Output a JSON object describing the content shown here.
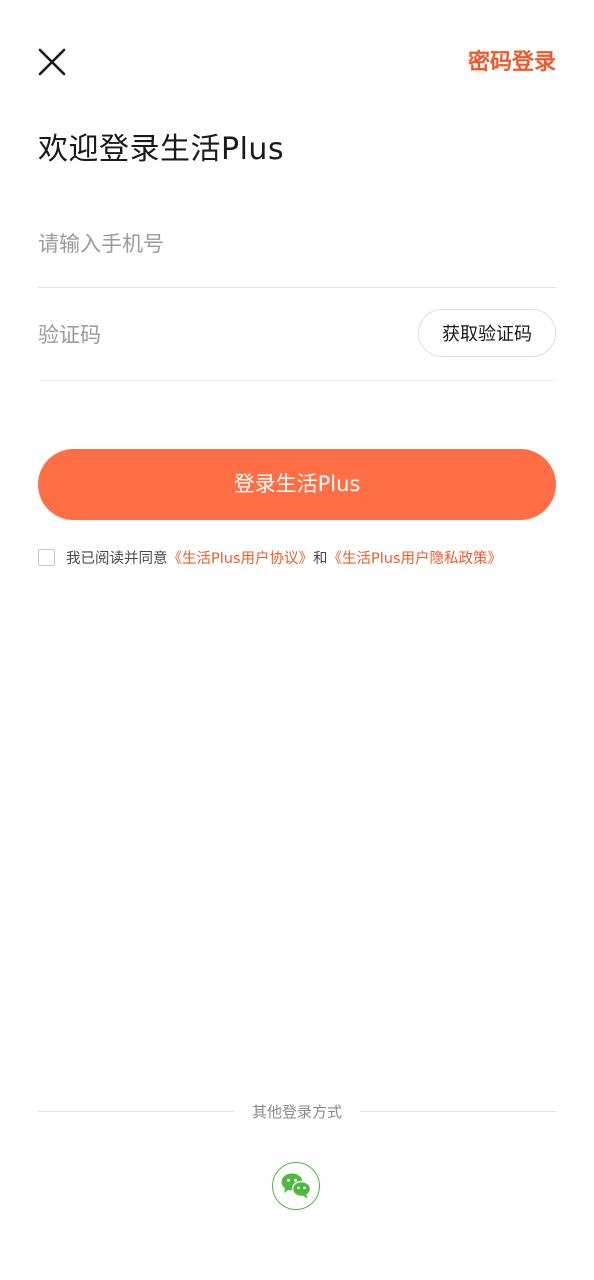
{
  "header": {
    "close_icon": "close-icon",
    "password_login_label": "密码登录"
  },
  "title": "欢迎登录生活Plus",
  "form": {
    "phone_value": "",
    "phone_placeholder": "请输入手机号",
    "code_value": "",
    "code_placeholder": "验证码",
    "get_code_label": "获取验证码"
  },
  "login_button_label": "登录生活Plus",
  "agreement": {
    "checked": false,
    "prefix": "我已阅读并同意",
    "user_agreement": "《生活Plus用户协议》",
    "conjunction": "和",
    "privacy_policy": "《生活Plus用户隐私政策》"
  },
  "other_login": {
    "label": "其他登录方式",
    "wechat_icon": "wechat-icon"
  },
  "colors": {
    "accent": "#ff6e45",
    "link": "#ef5a2b",
    "wechat": "#4cba3d"
  }
}
